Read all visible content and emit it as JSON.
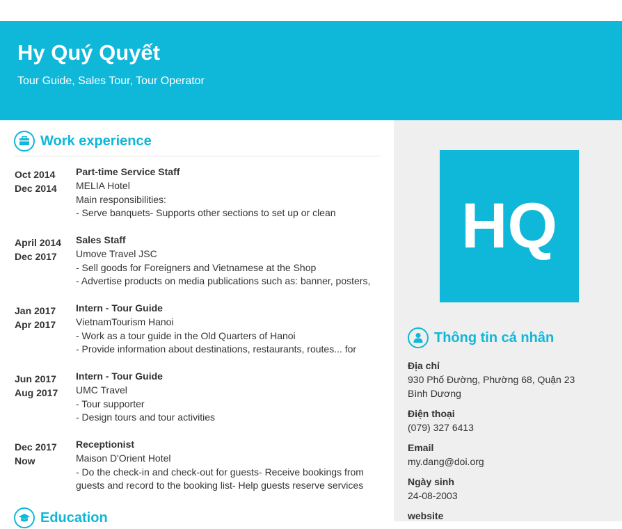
{
  "header": {
    "name": "Hy Quý Quyết",
    "subtitle": "Tour Guide, Sales Tour, Tour Operator"
  },
  "colors": {
    "accent": "#0fb7d9",
    "sidebar_bg": "#efefef",
    "text": "#333333"
  },
  "work": {
    "title": "Work experience",
    "icon": "briefcase-icon",
    "entries": [
      {
        "start": "Oct 2014",
        "end": "Dec 2014",
        "position": "Part-time Service Staff",
        "company": "MELIA Hotel",
        "lines": [
          "Main responsibilities:",
          "- Serve banquets- Supports other sections to set up or clean"
        ]
      },
      {
        "start": "April 2014",
        "end": "Dec 2017",
        "position": "Sales Staff",
        "company": "Umove Travel JSC",
        "lines": [
          "- Sell goods for Foreigners and Vietnamese at the Shop",
          "- Advertise products on media publications such as: banner, posters,"
        ]
      },
      {
        "start": "Jan 2017",
        "end": "Apr 2017",
        "position": "Intern - Tour Guide",
        "company": "VietnamTourism Hanoi",
        "lines": [
          "- Work as a tour guide in the Old Quarters of Hanoi",
          "- Provide information about destinations, restaurants, routes... for"
        ]
      },
      {
        "start": "Jun 2017",
        "end": "Aug 2017",
        "position": "Intern - Tour Guide",
        "company": "UMC Travel",
        "lines": [
          "- Tour supporter",
          "- Design tours and tour activities"
        ]
      },
      {
        "start": "Dec 2017",
        "end": "Now",
        "position": "Receptionist",
        "company": "Maison D'Orient Hotel",
        "lines": [
          "- Do the check-in and check-out for guests- Receive bookings from",
          "guests and record to the booking list- Help guests reserve services"
        ]
      }
    ]
  },
  "education": {
    "title": "Education",
    "icon": "graduation-cap-icon"
  },
  "sidebar": {
    "avatar_initials": "HQ",
    "personal": {
      "title": "Thông tin cá nhân",
      "icon": "user-icon",
      "items": [
        {
          "label": "Địa chỉ",
          "value": "930 Phố Đường, Phường 68, Quận 23 Bình Dương"
        },
        {
          "label": "Điện thoại",
          "value": "(079) 327 6413"
        },
        {
          "label": "Email",
          "value": "my.dang@doi.org"
        },
        {
          "label": "Ngày sinh",
          "value": "24-08-2003"
        },
        {
          "label": "website",
          "value": ""
        }
      ]
    }
  }
}
